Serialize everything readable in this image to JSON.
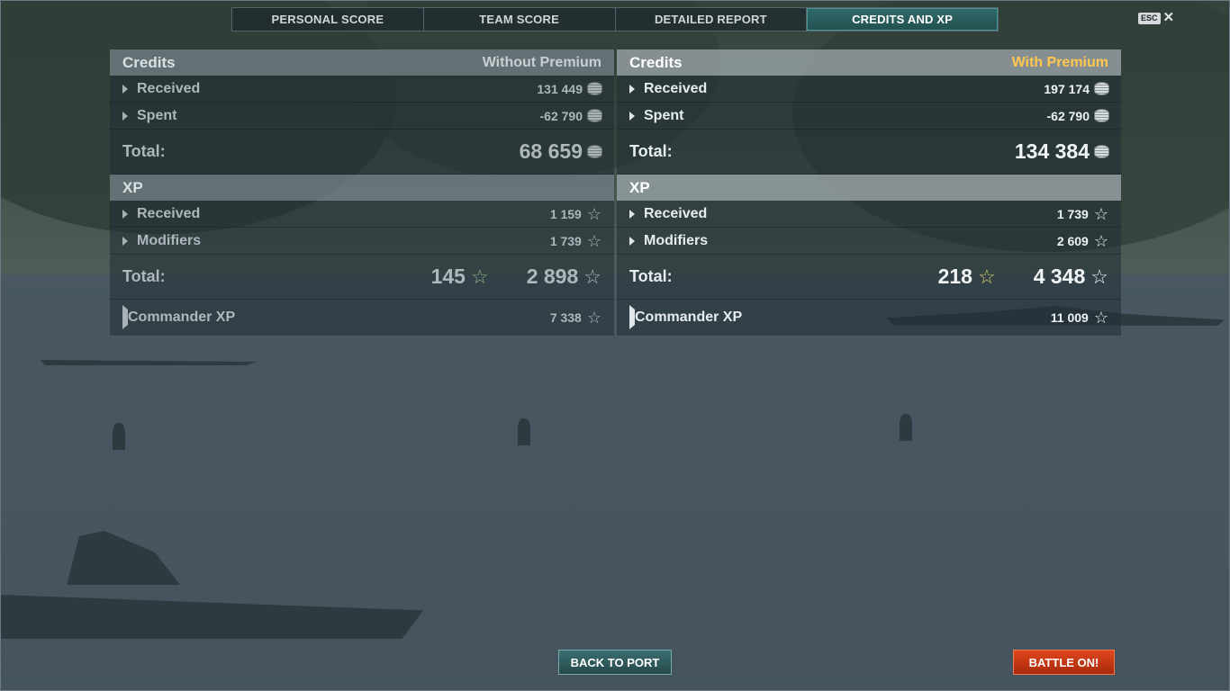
{
  "tabs": [
    {
      "label": "PERSONAL SCORE",
      "active": false
    },
    {
      "label": "TEAM SCORE",
      "active": false
    },
    {
      "label": "DETAILED REPORT",
      "active": false
    },
    {
      "label": "CREDITS AND XP",
      "active": true
    }
  ],
  "esc": {
    "key": "ESC",
    "close": "✕"
  },
  "without_premium": {
    "credits": {
      "title": "Credits",
      "mode_label": "Without Premium",
      "received_label": "Received",
      "received": "131 449",
      "spent_label": "Spent",
      "spent": "-62 790",
      "total_label": "Total:",
      "total": "68 659"
    },
    "xp": {
      "title": "XP",
      "received_label": "Received",
      "received": "1 159",
      "modifiers_label": "Modifiers",
      "modifiers": "1 739",
      "total_label": "Total:",
      "free_xp": "145",
      "total": "2 898",
      "commander_label": "Commander XP",
      "commander": "7 338"
    }
  },
  "with_premium": {
    "credits": {
      "title": "Credits",
      "mode_label": "With Premium",
      "received_label": "Received",
      "received": "197 174",
      "spent_label": "Spent",
      "spent": "-62 790",
      "total_label": "Total:",
      "total": "134 384"
    },
    "xp": {
      "title": "XP",
      "received_label": "Received",
      "received": "1 739",
      "modifiers_label": "Modifiers",
      "modifiers": "2 609",
      "total_label": "Total:",
      "free_xp": "218",
      "total": "4 348",
      "commander_label": "Commander XP",
      "commander": "11 009"
    }
  },
  "buttons": {
    "back_to_port": "BACK TO PORT",
    "battle_on": "BATTLE ON!"
  },
  "icons": {
    "credits": "credits-coin-icon",
    "xp": "xp-star-icon",
    "expand": "expand-triangle-icon"
  },
  "colors": {
    "active_tab": "#2f6a6a",
    "premium_label": "#ffc74f",
    "free_xp": "#c9f29a",
    "battle_button": "#d23a14"
  }
}
